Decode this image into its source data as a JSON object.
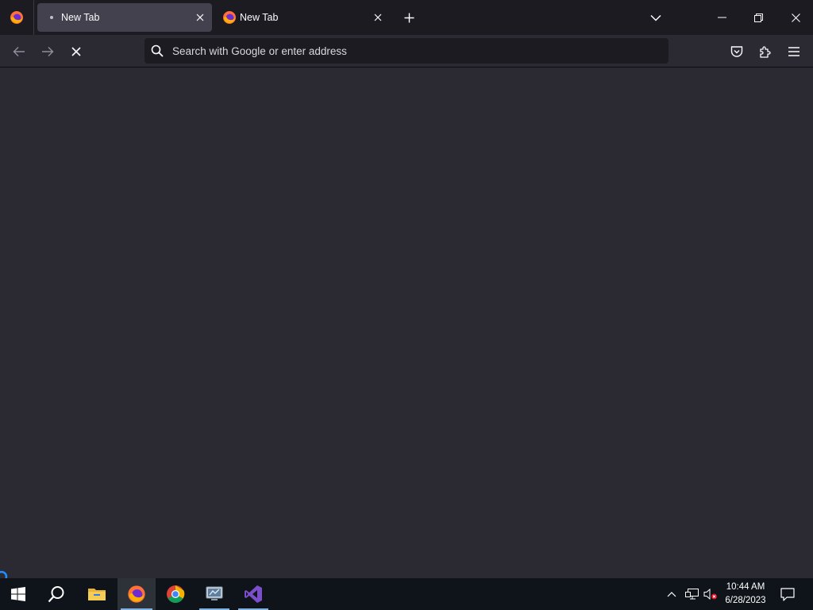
{
  "browser": {
    "tabs": [
      {
        "title": "New Tab",
        "state": "active-loading",
        "favicon": "loading-dot-icon"
      },
      {
        "title": "New Tab",
        "state": "inactive",
        "favicon": "firefox-icon"
      }
    ],
    "urlbar": {
      "placeholder": "Search with Google or enter address",
      "value": ""
    },
    "icons": {
      "menu_logo": "firefox-icon",
      "new_tab": "plus-icon",
      "tab_list": "chevron-down-icon",
      "back": "arrow-left-icon",
      "forward": "arrow-right-icon",
      "stop": "stop-x-icon",
      "pocket": "pocket-icon",
      "extensions": "puzzle-icon",
      "app_menu": "hamburger-icon"
    },
    "colors": {
      "tabstrip_bg": "#1c1b22",
      "toolbar_bg": "#2b2a33",
      "active_tab_bg": "#42414d",
      "urlbar_bg": "#1c1b22",
      "content_bg": "#2b2a33"
    }
  },
  "taskbar": {
    "apps": [
      {
        "name": "start",
        "icon": "windows-logo-icon"
      },
      {
        "name": "search",
        "icon": "search-icon"
      },
      {
        "name": "file-explorer",
        "icon": "folder-icon"
      },
      {
        "name": "firefox",
        "icon": "firefox-icon",
        "active": true
      },
      {
        "name": "chrome",
        "icon": "chrome-icon"
      },
      {
        "name": "remote-desktop",
        "icon": "remote-desktop-icon"
      },
      {
        "name": "visual-studio",
        "icon": "visual-studio-icon"
      }
    ],
    "clock": {
      "time": "10:44 AM",
      "date": "6/28/2023"
    },
    "tray_icons": [
      "chevron-up-icon",
      "network-icon",
      "volume-muted-icon",
      "notifications-icon"
    ],
    "colors": {
      "bg": "#0e1419",
      "active_app_bg": "#2c3238",
      "accent": "#7fb2e0"
    }
  }
}
